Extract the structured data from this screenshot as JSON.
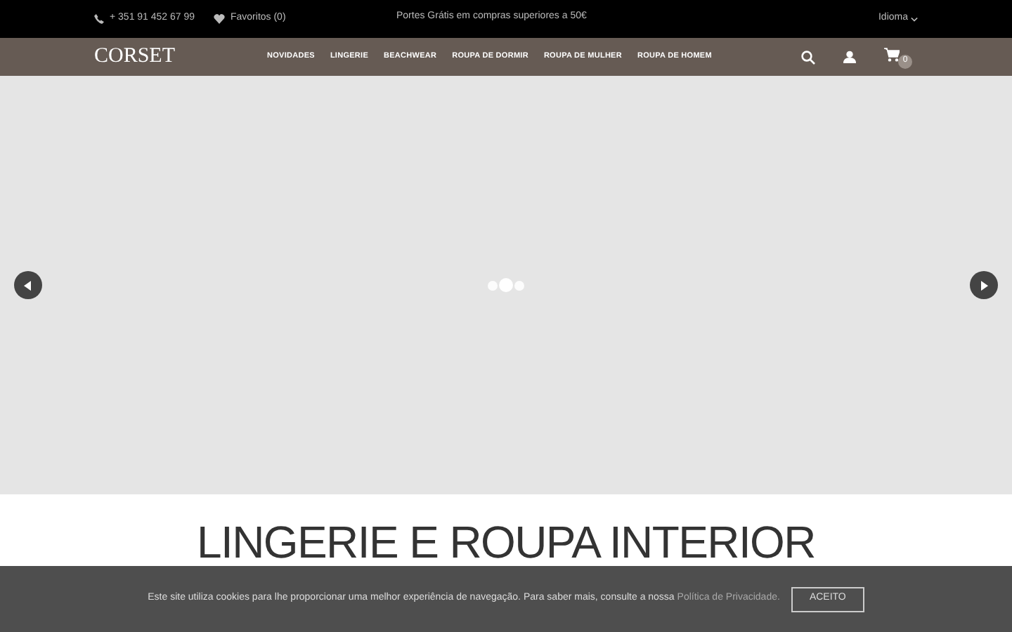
{
  "topbar": {
    "phone": "+ 351 91 452 67 99",
    "favorites": "Favoritos (0)",
    "promo": "Portes Grátis em compras superiores a 50€",
    "language": "Idioma"
  },
  "nav": {
    "logo": "CORSET",
    "items": [
      {
        "label": "NOVIDADES"
      },
      {
        "label": "LINGERIE"
      },
      {
        "label": "BEACHWEAR"
      },
      {
        "label": "ROUPA DE DORMIR"
      },
      {
        "label": "ROUPA DE MULHER"
      },
      {
        "label": "ROUPA DE HOMEM"
      }
    ],
    "cart_count": "0"
  },
  "slider": {
    "dots": [
      {
        "selected": false
      },
      {
        "selected": true
      },
      {
        "selected": false
      }
    ]
  },
  "section": {
    "heading": "LINGERIE E ROUPA INTERIOR"
  },
  "cookie_bar": {
    "text": "Este site utiliza cookies para lhe proporcionar uma melhor experiência de navegação. Para saber mais, consulte a nossa",
    "link": "Política de Privacidade.",
    "button": "ACEITO"
  }
}
